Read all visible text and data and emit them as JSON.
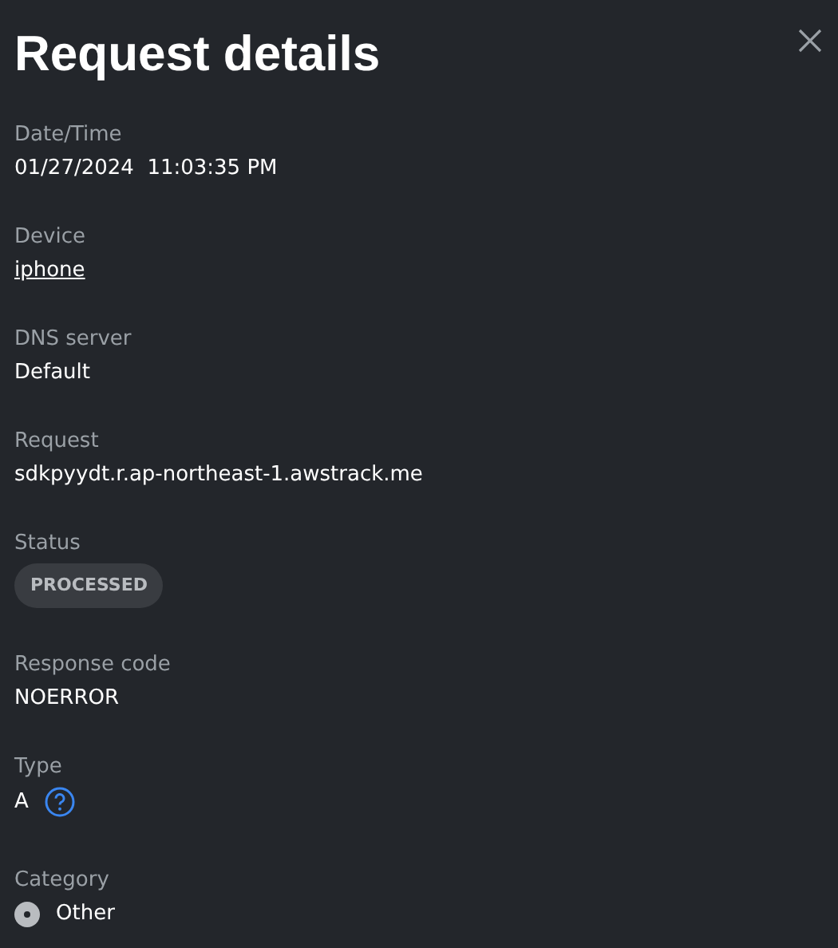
{
  "title": "Request details",
  "fields": [
    {
      "label": "Date/Time",
      "kind": "text",
      "value": "01/27/2024  11:03:35 PM"
    },
    {
      "label": "Device",
      "kind": "link",
      "value": "iphone"
    },
    {
      "label": "DNS server",
      "kind": "text",
      "value": "Default"
    },
    {
      "label": "Request",
      "kind": "text",
      "value": "sdkpyydt.r.ap-northeast-1.awstrack.me"
    },
    {
      "label": "Status",
      "kind": "badge",
      "value": "PROCESSED"
    },
    {
      "label": "Response code",
      "kind": "text",
      "value": "NOERROR"
    },
    {
      "label": "Type",
      "kind": "help",
      "value": "A"
    },
    {
      "label": "Category",
      "kind": "category",
      "value": "Other"
    }
  ]
}
